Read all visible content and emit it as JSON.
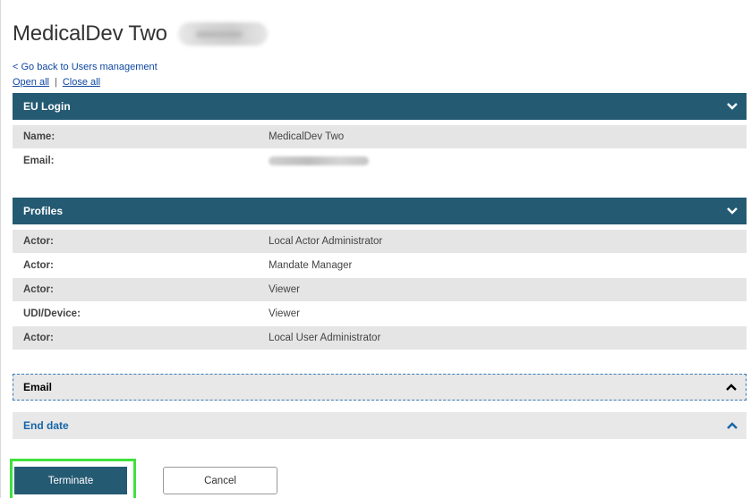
{
  "header": {
    "title": "MedicalDev Two"
  },
  "nav": {
    "back_link": "< Go back to Users management",
    "open_all": "Open all",
    "separator": "|",
    "close_all": "Close all"
  },
  "eu_login": {
    "title": "EU Login",
    "rows": [
      {
        "key": "Name:",
        "value": "MedicalDev  Two"
      },
      {
        "key": "Email:",
        "value": ""
      }
    ]
  },
  "profiles": {
    "title": "Profiles",
    "rows": [
      {
        "key": "Actor:",
        "value": "Local Actor Administrator"
      },
      {
        "key": "Actor:",
        "value": "Mandate Manager"
      },
      {
        "key": "Actor:",
        "value": "Viewer"
      },
      {
        "key": "UDI/Device:",
        "value": "Viewer"
      },
      {
        "key": "Actor:",
        "value": "Local User Administrator"
      }
    ]
  },
  "sections": {
    "email": {
      "label": "Email",
      "color": "#000000"
    },
    "end_date": {
      "label": "End date",
      "color": "#1565a8"
    }
  },
  "actions": {
    "terminate": "Terminate",
    "cancel": "Cancel"
  },
  "colors": {
    "header_bg": "#255a73",
    "row_grey": "#e5e5e5",
    "link": "#0e47a1",
    "highlight": "#3ee13b"
  },
  "icons": {
    "expanded": "chevron-down-icon",
    "collapsed": "chevron-up-icon"
  }
}
